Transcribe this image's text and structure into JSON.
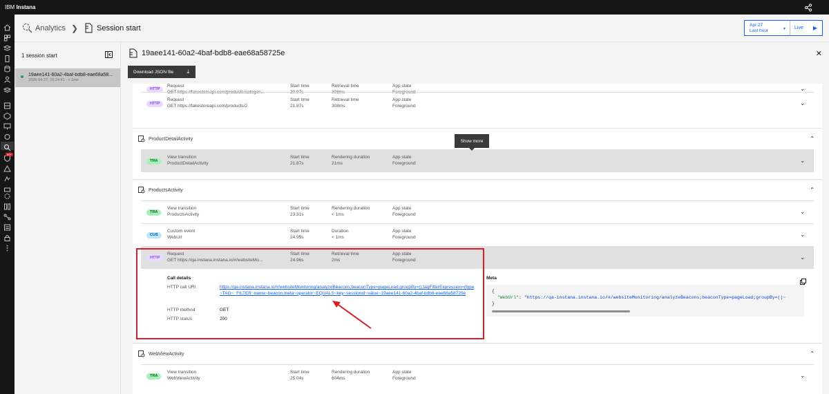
{
  "app": {
    "brand_prefix": "IBM ",
    "brand_name": "Instana"
  },
  "header": {
    "breadcrumb_root": "Analytics",
    "breadcrumb_current": "Session start",
    "time_date": "Apr 27",
    "time_range": "Last hour",
    "live_label": "Live"
  },
  "rail": {
    "alert_badge": "99+"
  },
  "sessions": {
    "header": "1 session start",
    "items": [
      {
        "id": "19aee141-60a2-4baf-bdb8-eae68a58...",
        "meta": "2026-04-27, 16:24:41 · < 1ms"
      }
    ]
  },
  "detail": {
    "title": "19aee141-60a2-4baf-bdb8-eae68a58725e",
    "download_label": "Download JSON file",
    "tooltip": "Show more",
    "groups": [
      {
        "name": "",
        "rows": [
          {
            "tag": "HTTP",
            "type": "Request",
            "name": "GET https://fakestoreapi.com/products/categori...",
            "l2": "Start time",
            "v2": "20.97s",
            "l3": "Retrieval time",
            "v3": "308ms",
            "l4": "App state",
            "v4": "Foreground"
          },
          {
            "tag": "HTTP",
            "type": "Request",
            "name": "GET https://fakestoreapi.com/products/2",
            "l2": "Start time",
            "v2": "21.87s",
            "l3": "Retrieval time",
            "v3": "308ms",
            "l4": "App state",
            "v4": "Foreground"
          }
        ]
      },
      {
        "name": "ProductDetailActivity",
        "rows": [
          {
            "tag": "TRA",
            "type": "View transition",
            "name": "ProductDetailActivity",
            "l2": "Start time",
            "v2": "21.87s",
            "l3": "Rendering duration",
            "v3": "21ms",
            "l4": "App state",
            "v4": "Foreground"
          }
        ]
      },
      {
        "name": "ProductsActivity",
        "rows": [
          {
            "tag": "TRA",
            "type": "View transition",
            "name": "ProductsActivity",
            "l2": "Start time",
            "v2": "23.31s",
            "l3": "Rendering duration",
            "v3": "< 1ms",
            "l4": "App state",
            "v4": "Foreground"
          },
          {
            "tag": "CUS",
            "type": "Custom event",
            "name": "WebUrl",
            "l2": "Start time",
            "v2": "24.95s",
            "l3": "Duration",
            "v3": "< 1ms",
            "l4": "App state",
            "v4": "Foreground"
          },
          {
            "tag": "HTTP",
            "type": "Request",
            "name": "GET https://qa-instana.instana.io/#/websiteMo...",
            "l2": "Start time",
            "v2": "24.96s",
            "l3": "Retrieval time",
            "v3": "2ms",
            "l4": "App state",
            "v4": "Foreground"
          }
        ]
      },
      {
        "name": "WebViewActivity",
        "rows": [
          {
            "tag": "TRA",
            "type": "View transition",
            "name": "WebViewActivity",
            "l2": "Start time",
            "v2": "25.04s",
            "l3": "Rendering duration",
            "v3": "604ms",
            "l4": "App state",
            "v4": "Foreground"
          }
        ]
      }
    ],
    "call_details": {
      "title": "Call details",
      "uri_label": "HTTP call URI",
      "uri_value": "https://qa-instana.instana.io/#/websiteMonitoring/analyzeBeacons;beaconType=pageLoad;groupBy=();tagFilterExpression=(type~TAG~_FILTER~name~beacon.meta~operator~EQUALS~key~sessionid~value~19aee141-60a2-4baf-bdb8-eae68a58725e",
      "method_label": "HTTP method",
      "method_value": "GET",
      "status_label": "HTTP status",
      "status_value": "200"
    },
    "meta": {
      "title": "Meta",
      "open": "{",
      "key": "\"WebUrl\"",
      "colon": ": ",
      "value": "\"https://qa-instana.instana.io/#/websiteMonitoring/analyzeBeacons;beaconType=pageLoad;groupBy=()~",
      "close": "}"
    }
  }
}
